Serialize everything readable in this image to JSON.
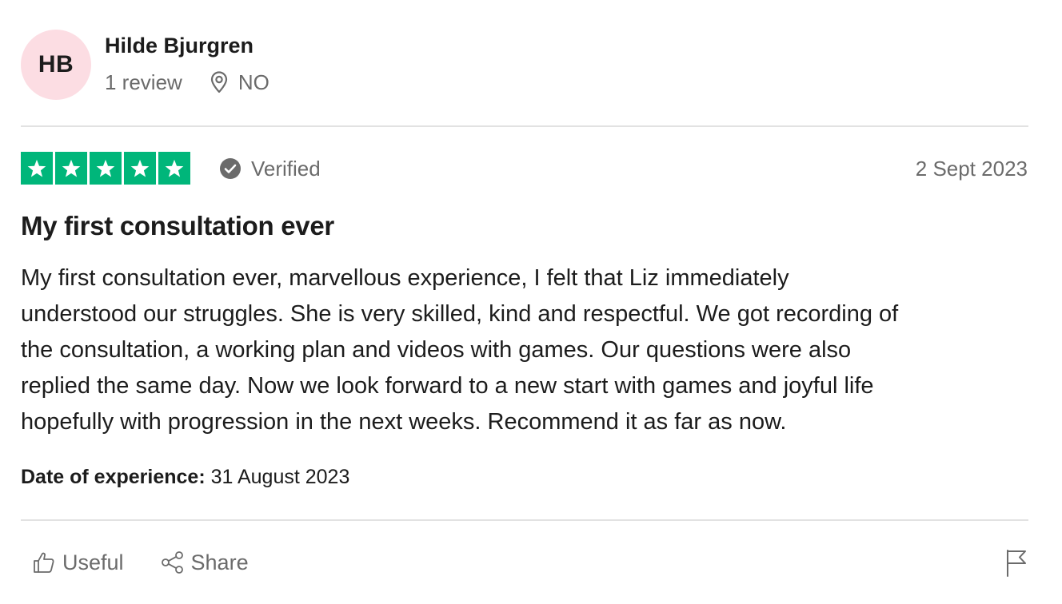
{
  "reviewer": {
    "initials": "HB",
    "name": "Hilde Bjurgren",
    "review_count": "1 review",
    "country": "NO",
    "avatar_color": "#fcdde3"
  },
  "rating": {
    "stars": 5,
    "max_stars": 5,
    "star_color": "#00b67a",
    "verified_label": "Verified",
    "date": "2 Sept 2023"
  },
  "review": {
    "title": "My first consultation ever",
    "body_lines": [
      "My first consultation ever, marvellous experience, I felt that Liz immediately",
      "understood our struggles. She is very skilled, kind and respectful. We got recording of",
      "the consultation, a working plan and videos with games. Our questions were also",
      "replied the same day. Now we look forward to a new start with games and joyful life",
      "hopefully with progression in the next weeks. Recommend it as far as now."
    ],
    "experience_label": "Date of experience:",
    "experience_date": "31 August 2023"
  },
  "actions": {
    "useful_label": "Useful",
    "share_label": "Share",
    "useful_icon": "thumbs-up-icon",
    "share_icon": "share-icon",
    "flag_icon": "flag-icon"
  }
}
